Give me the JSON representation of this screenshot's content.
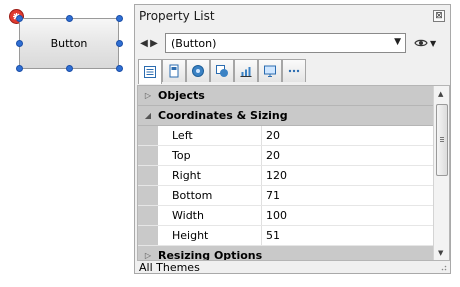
{
  "canvas": {
    "button_label": "Button"
  },
  "panel": {
    "title": "Property List",
    "close_glyph": "⊠",
    "selector": {
      "value": "(Button)"
    },
    "tabs": [
      {
        "icon": "property-list-icon",
        "active": true
      },
      {
        "icon": "page-icon"
      },
      {
        "icon": "style-icon"
      },
      {
        "icon": "states-icon"
      },
      {
        "icon": "chart-icon"
      },
      {
        "icon": "monitor-icon"
      },
      {
        "icon": "more-icon"
      }
    ],
    "categories": {
      "objects": "Objects",
      "coordinates": "Coordinates & Sizing",
      "resizing": "Resizing Options"
    },
    "properties": [
      {
        "name": "Left",
        "value": "20"
      },
      {
        "name": "Top",
        "value": "20"
      },
      {
        "name": "Right",
        "value": "120"
      },
      {
        "name": "Bottom",
        "value": "71"
      },
      {
        "name": "Width",
        "value": "100"
      },
      {
        "name": "Height",
        "value": "51"
      }
    ],
    "status": "All Themes"
  },
  "colors": {
    "handle": "#2f6fd3",
    "category_bg": "#c9c9c9",
    "anchor": "#e03a30"
  }
}
